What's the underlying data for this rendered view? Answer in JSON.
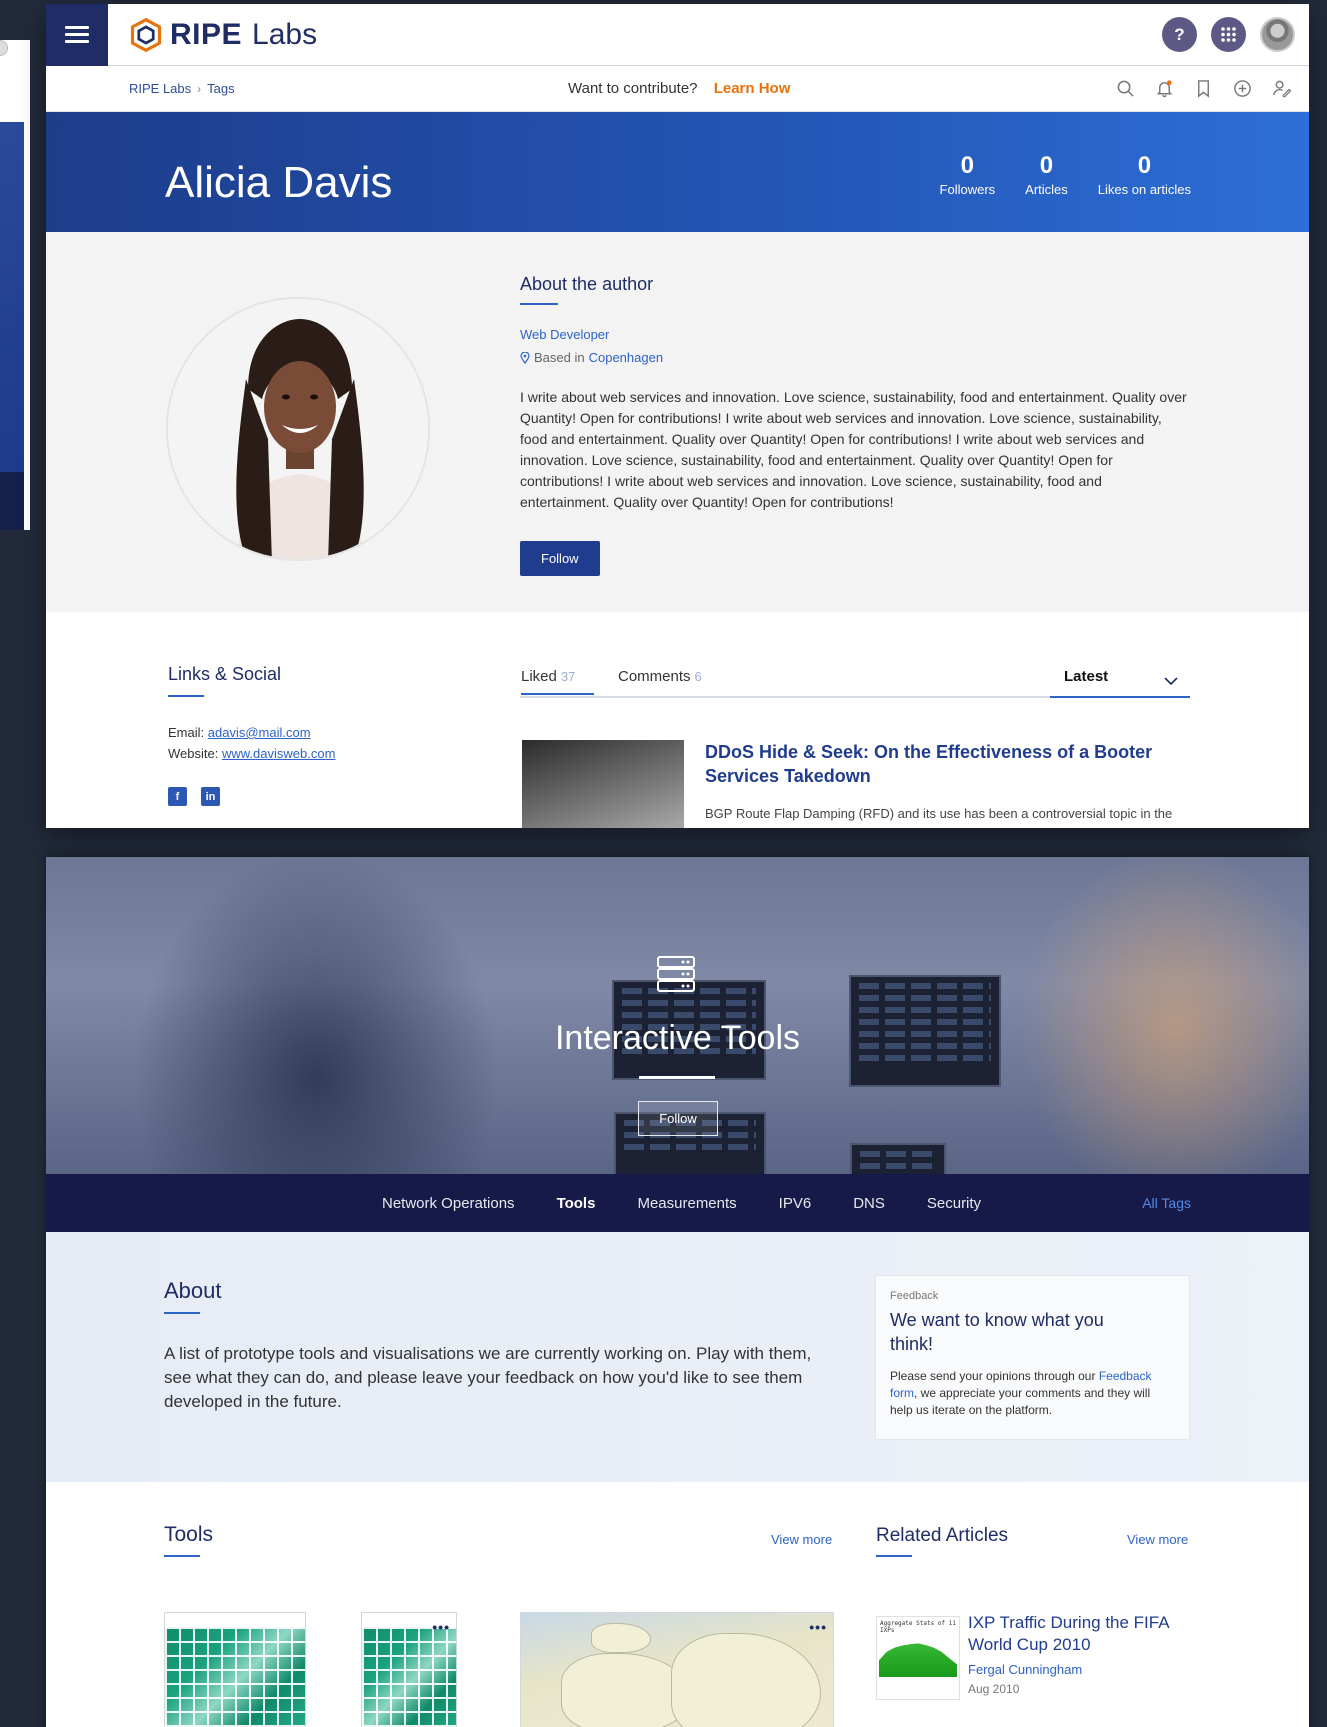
{
  "header": {
    "logo_brand": "RIPE",
    "logo_sub": "Labs",
    "help_label": "?",
    "breadcrumb": [
      "RIPE Labs",
      "Tags"
    ],
    "contribute_text": "Want to contribute?",
    "contribute_link": "Learn How"
  },
  "profile": {
    "name": "Alicia Davis",
    "stats": [
      {
        "value": "0",
        "label": "Followers"
      },
      {
        "value": "0",
        "label": "Articles"
      },
      {
        "value": "0",
        "label": "Likes on articles"
      }
    ],
    "about_heading": "About the author",
    "job": "Web Developer",
    "based_prefix": "Based in",
    "city": "Copenhagen",
    "bio": "I write about web services and innovation. Love science, sustainability, food and entertainment. Quality over Quantity! Open for contributions! I write about web services and innovation. Love science, sustainability, food and entertainment. Quality over Quantity! Open for contributions! I write about web services and innovation. Love science, sustainability, food and entertainment. Quality over Quantity! Open for contributions! I write about web services and innovation. Love science, sustainability, food and entertainment. Quality over Quantity! Open for contributions!",
    "follow_label": "Follow"
  },
  "links": {
    "heading": "Links & Social",
    "email_label": "Email:",
    "email": "adavis@mail.com",
    "website_label": "Website:",
    "website": "www.davisweb.com",
    "facebook": "f",
    "linkedin": "in"
  },
  "activity": {
    "tabs": [
      {
        "label": "Liked",
        "count": "37"
      },
      {
        "label": "Comments",
        "count": "6"
      }
    ],
    "sort_label": "Latest",
    "article": {
      "title": "DDoS Hide & Seek: On the Effectiveness of a Booter Services Takedown",
      "excerpt": "BGP Route Flap Damping (RFD) and its use has been a controversial topic in the past."
    }
  },
  "tag_page": {
    "title": "Interactive Tools",
    "follow_label": "Follow",
    "nav": [
      "Network Operations",
      "Tools",
      "Measurements",
      "IPV6",
      "DNS",
      "Security"
    ],
    "nav_active": "Tools",
    "all_tags": "All Tags",
    "about_heading": "About",
    "about_text": "A list of prototype tools and visualisations we are currently working on. Play with them, see what they can do, and please leave your feedback on how you'd like to see them developed in the future.",
    "feedback": {
      "kicker": "Feedback",
      "heading": "We want to know what you think!",
      "body_before": "Please send your opinions through our ",
      "link": "Feedback form",
      "body_after": ", we appreciate your comments and they will help us iterate on the platform."
    },
    "tools_heading": "Tools",
    "tools_view_more": "View more",
    "related_heading": "Related Articles",
    "related_view_more": "View more",
    "related": {
      "title": "IXP Traffic During the FIFA World Cup 2010",
      "author": "Fergal Cunningham",
      "date": "Aug 2010",
      "thumb_caption": "Aggregate Stats of 11 IXPs"
    }
  },
  "colors": {
    "navy": "#1f2c66",
    "brand_blue": "#2c63c7",
    "accent_orange": "#e8720c",
    "nav_dark": "#171a48"
  }
}
